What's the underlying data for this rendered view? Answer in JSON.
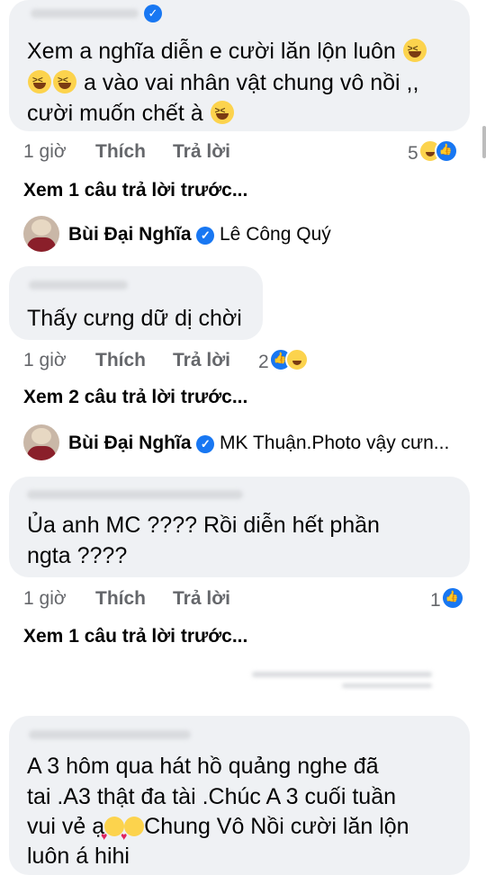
{
  "comments": [
    {
      "lines": [
        "Xem a nghĩa diễn e cười lăn lộn luôn",
        "a vào vai nhân vật  chung vô nồi ,,",
        "cười muốn chết à"
      ],
      "time": "1 giờ",
      "like": "Thích",
      "reply": "Trả lời",
      "reaction_count": "5",
      "see_more": "Xem 1 câu trả lời trước..."
    },
    {
      "lines": [
        "Thấy cưng dữ dị chời"
      ],
      "time": "1 giờ",
      "like": "Thích",
      "reply": "Trả lời",
      "reaction_count": "2",
      "see_more": "Xem 2 câu trả lời trước..."
    },
    {
      "lines": [
        "Ủa anh MC ???? Rồi diễn hết phần",
        "ngta ????"
      ],
      "time": "1 giờ",
      "like": "Thích",
      "reply": "Trả lời",
      "reaction_count": "1",
      "see_more": "Xem 1 câu trả lời trước..."
    },
    {
      "lines": [
        "A 3 hôm qua hát hồ quảng nghe đã",
        "tai  .A3 thật đa  tài .Chúc A 3 cuối tuần",
        "vui vẻ ạ",
        "Chung Vô Nồi cười lăn lộn",
        "luôn á hihi"
      ]
    }
  ],
  "replies": [
    {
      "author": "Bùi Đại Nghĩa",
      "text": "Lê Công Quý"
    },
    {
      "author": "Bùi Đại Nghĩa",
      "text": "MK Thuận.Photo  vậy cưn..."
    }
  ],
  "colors": {
    "bubble": "#eff1f4",
    "meta": "#65676b",
    "like_blue": "#1877f2"
  }
}
